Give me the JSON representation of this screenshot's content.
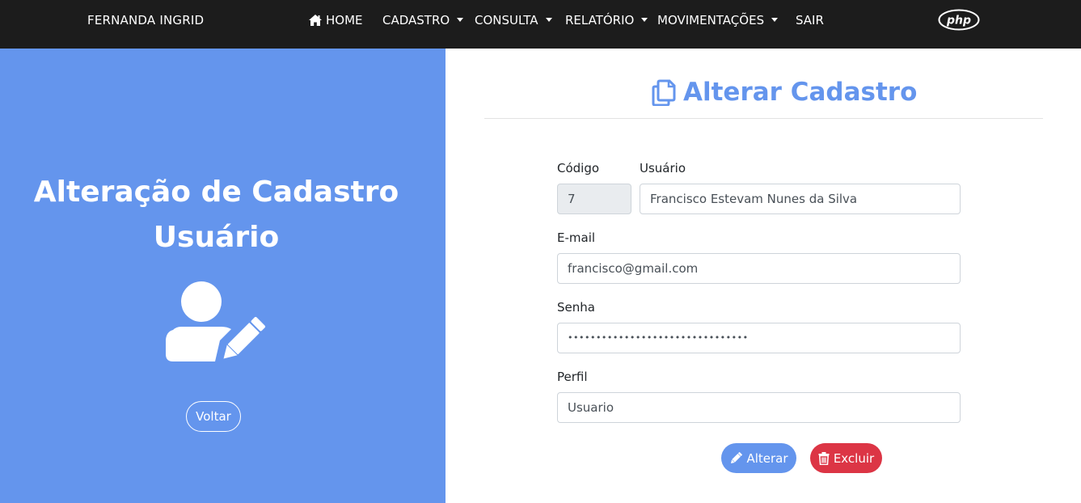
{
  "navbar": {
    "brand": "FERNANDA INGRID",
    "items": [
      {
        "label": "HOME",
        "icon": "home-icon"
      },
      {
        "label": "CADASTRO",
        "dropdown": true
      },
      {
        "label": "CONSULTA",
        "dropdown": true
      },
      {
        "label": "RELATÓRIO",
        "dropdown": true
      },
      {
        "label": "MOVIMENTAÇÕES",
        "dropdown": true
      },
      {
        "label": "SAIR"
      }
    ],
    "logo": "php"
  },
  "left_panel": {
    "title_line1": "Alteração de Cadastro",
    "title_line2": "Usuário",
    "icon": "user-edit-icon",
    "back_button": "Voltar",
    "background_color": "#6495ed"
  },
  "form": {
    "title": "Alterar Cadastro",
    "title_icon": "copy-icon",
    "fields": {
      "codigo": {
        "label": "Código",
        "value": "7"
      },
      "usuario": {
        "label": "Usuário",
        "value": "Francisco Estevam Nunes da Silva"
      },
      "email": {
        "label": "E-mail",
        "value": "francisco@gmail.com"
      },
      "senha": {
        "label": "Senha",
        "value": "••••••••••••••••••••••••••••••••"
      },
      "perfil": {
        "label": "Perfil",
        "value": "Usuario"
      }
    },
    "buttons": {
      "alterar": "Alterar",
      "excluir": "Excluir"
    },
    "colors": {
      "primary": "#6495ed",
      "danger": "#dc3545"
    }
  }
}
